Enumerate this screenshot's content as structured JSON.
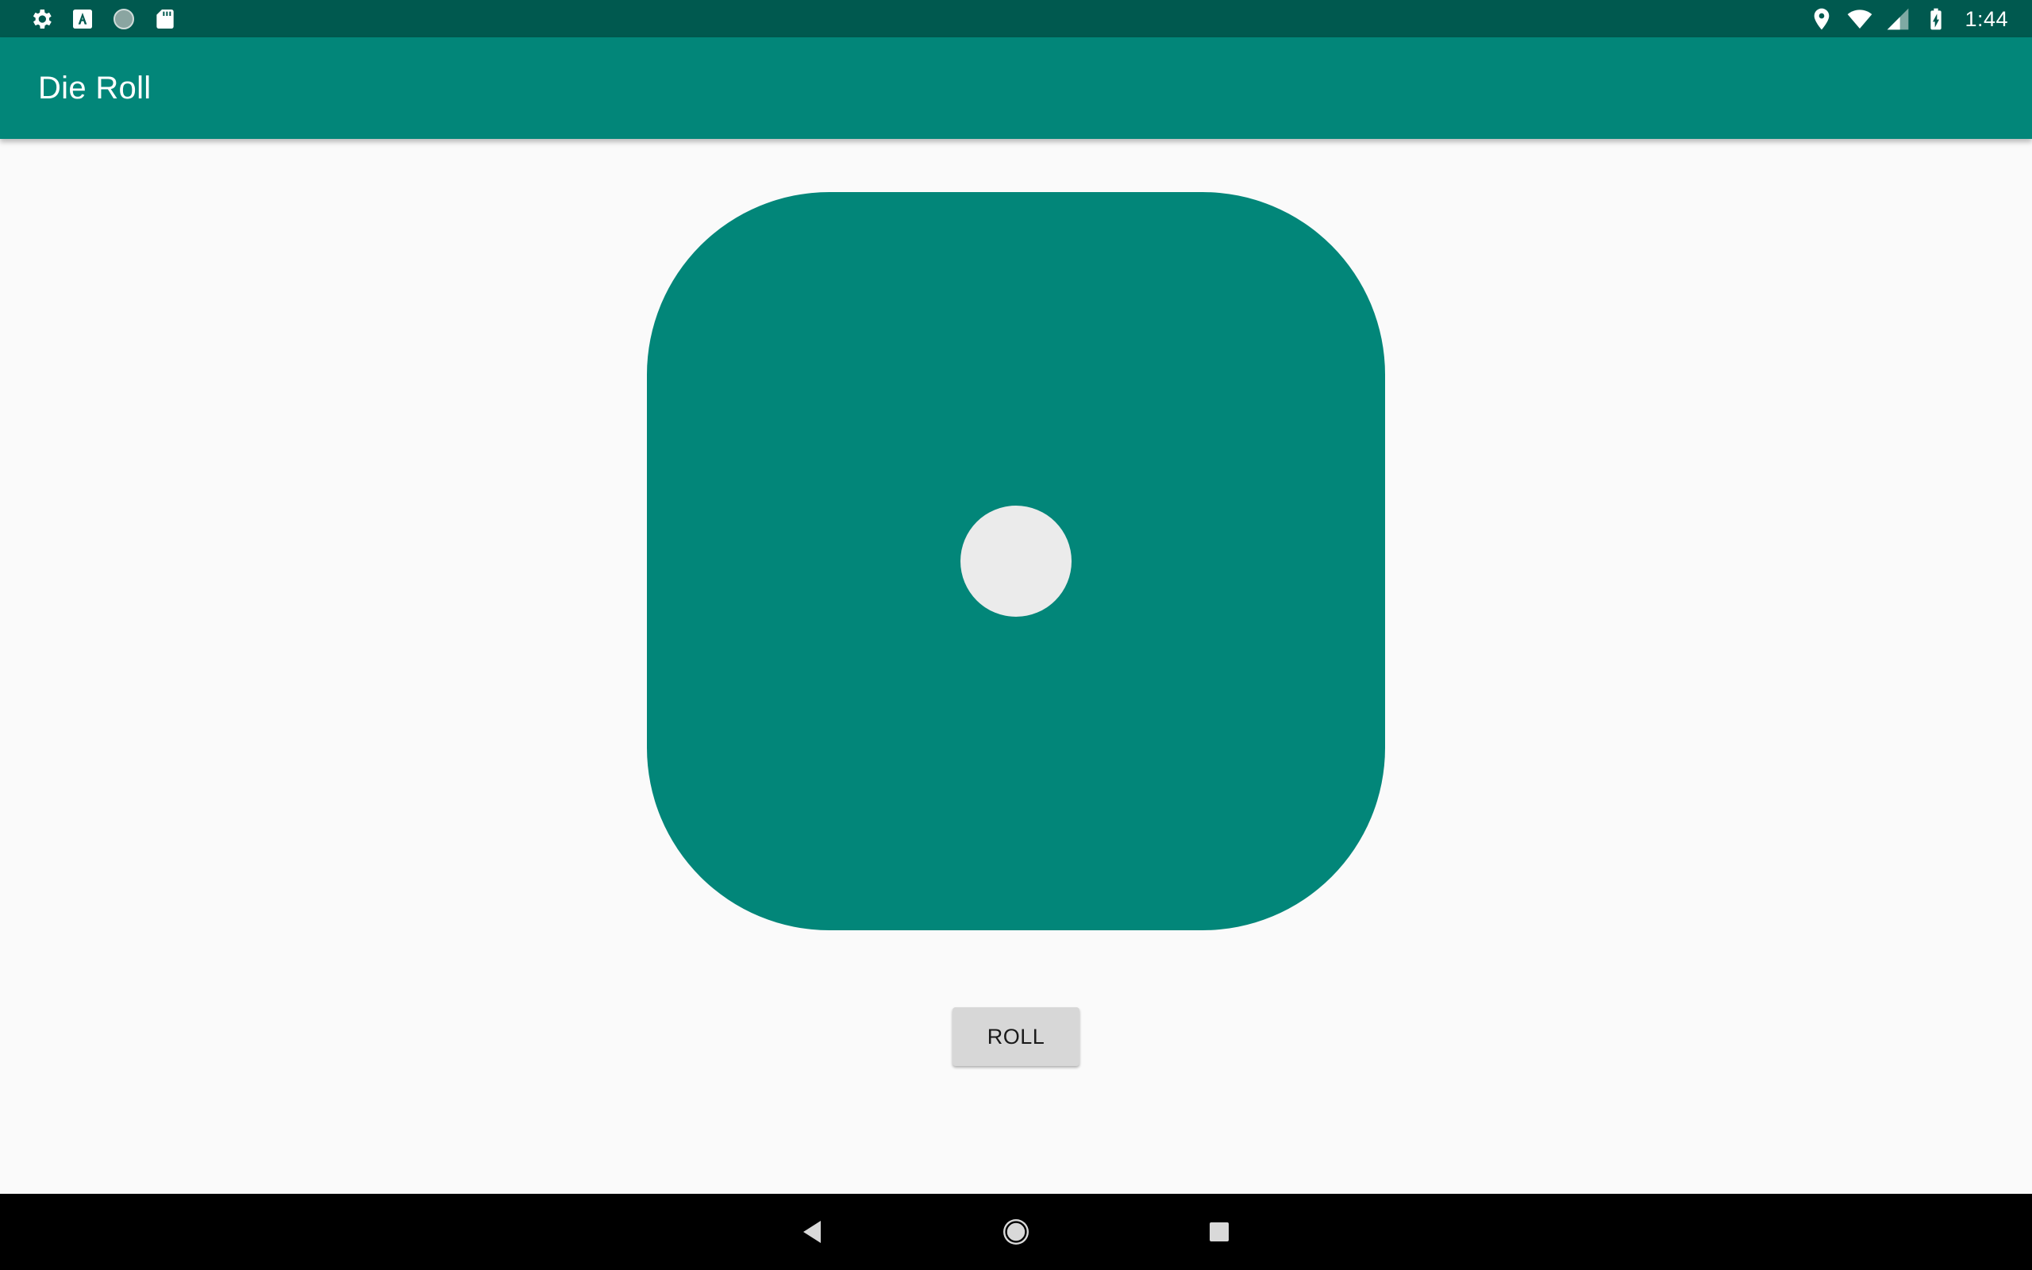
{
  "status_bar": {
    "time": "1:44",
    "left_icons": [
      "gear-icon",
      "text-a-icon",
      "circle-icon",
      "sd-card-icon"
    ],
    "right_icons": [
      "location-icon",
      "wifi-icon",
      "cell-signal-icon",
      "battery-icon"
    ]
  },
  "app_bar": {
    "title": "Die Roll"
  },
  "die": {
    "value": 1,
    "color": "#028679",
    "pip_color": "#ebebeb"
  },
  "roll_button": {
    "label": "ROLL"
  },
  "nav_bar": {
    "buttons": [
      "back-icon",
      "home-icon",
      "recents-icon"
    ]
  },
  "colors": {
    "status_bar": "#00594f",
    "app_bar": "#028679",
    "background": "#fafafa",
    "nav_bar": "#000000"
  }
}
